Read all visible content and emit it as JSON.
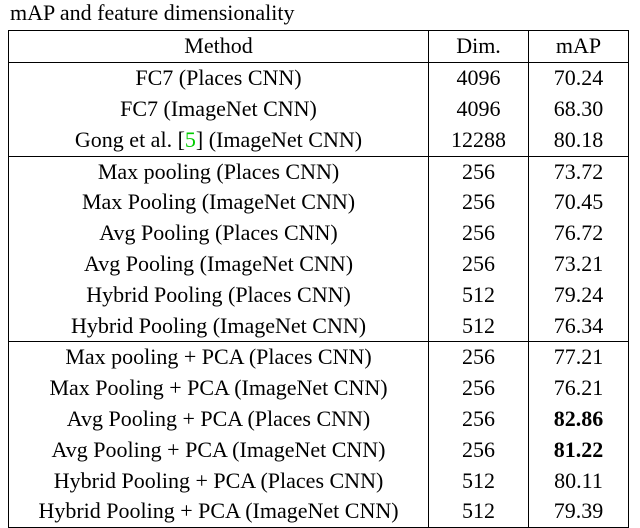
{
  "caption": "mAP and feature dimensionality",
  "headers": {
    "method": "Method",
    "dim": "Dim.",
    "map": "mAP"
  },
  "cite": {
    "label": "5"
  },
  "chart_data": {
    "type": "table",
    "title": "mAP and feature dimensionality",
    "columns": [
      "Method",
      "Dim.",
      "mAP"
    ],
    "groups": [
      {
        "rows": [
          {
            "method": "FC7 (Places CNN)",
            "dim": 4096,
            "map": 70.24
          },
          {
            "method": "FC7 (ImageNet CNN)",
            "dim": 4096,
            "map": 68.3
          },
          {
            "method": "Gong et al. [5] (ImageNet CNN)",
            "dim": 12288,
            "map": 80.18
          }
        ]
      },
      {
        "rows": [
          {
            "method": "Max pooling (Places CNN)",
            "dim": 256,
            "map": 73.72
          },
          {
            "method": "Max Pooling (ImageNet CNN)",
            "dim": 256,
            "map": 70.45
          },
          {
            "method": "Avg Pooling (Places CNN)",
            "dim": 256,
            "map": 76.72
          },
          {
            "method": "Avg Pooling (ImageNet CNN)",
            "dim": 256,
            "map": 73.21
          },
          {
            "method": "Hybrid Pooling (Places CNN)",
            "dim": 512,
            "map": 79.24
          },
          {
            "method": "Hybrid Pooling (ImageNet CNN)",
            "dim": 512,
            "map": 76.34
          }
        ]
      },
      {
        "rows": [
          {
            "method": "Max pooling + PCA (Places CNN)",
            "dim": 256,
            "map": 77.21
          },
          {
            "method": "Max Pooling + PCA (ImageNet CNN)",
            "dim": 256,
            "map": 76.21
          },
          {
            "method": "Avg Pooling + PCA (Places CNN)",
            "dim": 256,
            "map": 82.86,
            "bold": true
          },
          {
            "method": "Avg Pooling + PCA (ImageNet CNN)",
            "dim": 256,
            "map": 81.22,
            "bold": true
          },
          {
            "method": "Hybrid Pooling + PCA (Places CNN)",
            "dim": 512,
            "map": 80.11
          },
          {
            "method": "Hybrid Pooling + PCA (ImageNet CNN)",
            "dim": 512,
            "map": 79.39
          }
        ]
      }
    ]
  }
}
